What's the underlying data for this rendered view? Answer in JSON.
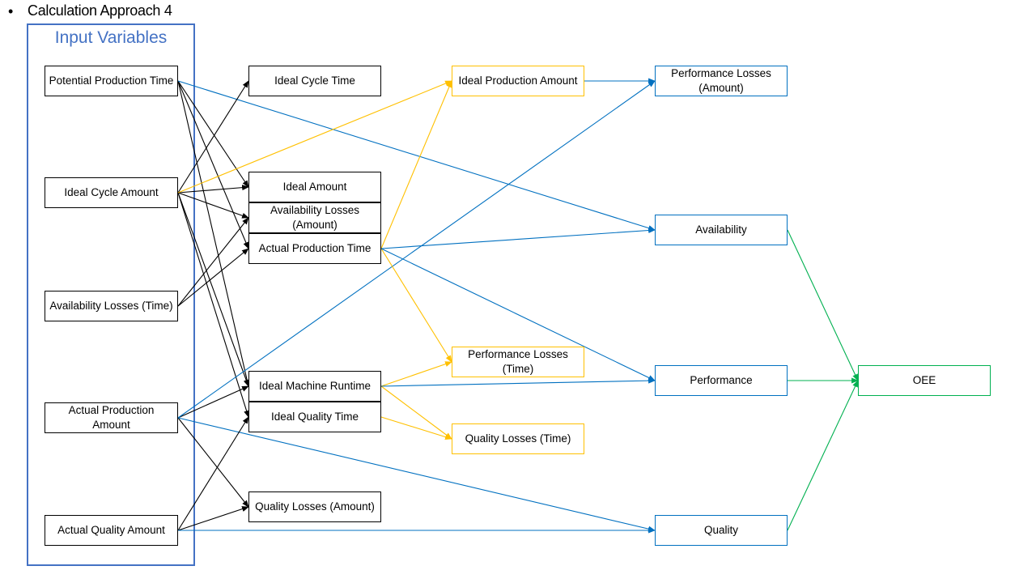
{
  "header": {
    "bullet": "•",
    "title": "Calculation Approach 4"
  },
  "group": {
    "title": "Input Variables"
  },
  "colors": {
    "input": "#000000",
    "intermediate": "#000000",
    "derived_yellow": "#FFC000",
    "kpi_blue": "#0070C0",
    "oee_green": "#00B050",
    "group_border": "#4472C4"
  },
  "nodes": [
    {
      "id": "potential_production_time",
      "label": "Potential Production Time",
      "color": "black"
    },
    {
      "id": "ideal_cycle_amount",
      "label": "Ideal Cycle Amount",
      "color": "black"
    },
    {
      "id": "availability_losses_time",
      "label": "Availability Losses (Time)",
      "color": "black"
    },
    {
      "id": "actual_production_amount",
      "label": "Actual Production Amount",
      "color": "black"
    },
    {
      "id": "actual_quality_amount",
      "label": "Actual Quality Amount",
      "color": "black"
    },
    {
      "id": "ideal_cycle_time",
      "label": "Ideal Cycle Time",
      "color": "black"
    },
    {
      "id": "ideal_amount",
      "label": "Ideal Amount",
      "color": "black"
    },
    {
      "id": "availability_losses_amount",
      "label": "Availability Losses (Amount)",
      "color": "black"
    },
    {
      "id": "actual_production_time",
      "label": "Actual Production Time",
      "color": "black"
    },
    {
      "id": "ideal_machine_runtime",
      "label": "Ideal Machine Runtime",
      "color": "black"
    },
    {
      "id": "ideal_quality_time",
      "label": "Ideal Quality Time",
      "color": "black"
    },
    {
      "id": "quality_losses_amount",
      "label": "Quality Losses (Amount)",
      "color": "black"
    },
    {
      "id": "ideal_production_amount",
      "label": "Ideal Production Amount",
      "color": "yellow"
    },
    {
      "id": "performance_losses_time",
      "label": "Performance Losses (Time)",
      "color": "yellow"
    },
    {
      "id": "quality_losses_time",
      "label": "Quality Losses (Time)",
      "color": "yellow"
    },
    {
      "id": "performance_losses_amount",
      "label": "Performance Losses (Amount)",
      "color": "blue"
    },
    {
      "id": "availability",
      "label": "Availability",
      "color": "blue"
    },
    {
      "id": "performance",
      "label": "Performance",
      "color": "blue"
    },
    {
      "id": "quality",
      "label": "Quality",
      "color": "blue"
    },
    {
      "id": "oee",
      "label": "OEE",
      "color": "green"
    }
  ],
  "edges": [
    {
      "from": "potential_production_time",
      "to": "ideal_amount",
      "color": "black"
    },
    {
      "from": "potential_production_time",
      "to": "actual_production_time",
      "color": "black"
    },
    {
      "from": "potential_production_time",
      "to": "ideal_machine_runtime",
      "color": "black"
    },
    {
      "from": "potential_production_time",
      "to": "availability",
      "color": "blue"
    },
    {
      "from": "ideal_cycle_amount",
      "to": "ideal_cycle_time",
      "color": "black"
    },
    {
      "from": "ideal_cycle_amount",
      "to": "ideal_amount",
      "color": "black"
    },
    {
      "from": "ideal_cycle_amount",
      "to": "availability_losses_amount",
      "color": "black"
    },
    {
      "from": "ideal_cycle_amount",
      "to": "ideal_machine_runtime",
      "color": "black"
    },
    {
      "from": "ideal_cycle_amount",
      "to": "ideal_quality_time",
      "color": "black"
    },
    {
      "from": "ideal_cycle_amount",
      "to": "ideal_production_amount",
      "color": "yellow"
    },
    {
      "from": "availability_losses_time",
      "to": "availability_losses_amount",
      "color": "black"
    },
    {
      "from": "availability_losses_time",
      "to": "actual_production_time",
      "color": "black"
    },
    {
      "from": "actual_production_amount",
      "to": "ideal_machine_runtime",
      "color": "black"
    },
    {
      "from": "actual_production_amount",
      "to": "quality_losses_amount",
      "color": "black"
    },
    {
      "from": "actual_production_amount",
      "to": "performance_losses_amount",
      "color": "blue"
    },
    {
      "from": "actual_production_amount",
      "to": "quality",
      "color": "blue"
    },
    {
      "from": "actual_quality_amount",
      "to": "ideal_quality_time",
      "color": "black"
    },
    {
      "from": "actual_quality_amount",
      "to": "quality_losses_amount",
      "color": "black"
    },
    {
      "from": "actual_quality_amount",
      "to": "quality",
      "color": "blue"
    },
    {
      "from": "actual_production_time",
      "to": "ideal_production_amount",
      "color": "yellow"
    },
    {
      "from": "actual_production_time",
      "to": "performance_losses_time",
      "color": "yellow"
    },
    {
      "from": "actual_production_time",
      "to": "availability",
      "color": "blue"
    },
    {
      "from": "actual_production_time",
      "to": "performance",
      "color": "blue"
    },
    {
      "from": "ideal_machine_runtime",
      "to": "performance_losses_time",
      "color": "yellow"
    },
    {
      "from": "ideal_machine_runtime",
      "to": "quality_losses_time",
      "color": "yellow"
    },
    {
      "from": "ideal_machine_runtime",
      "to": "performance",
      "color": "blue"
    },
    {
      "from": "ideal_quality_time",
      "to": "quality_losses_time",
      "color": "yellow"
    },
    {
      "from": "ideal_production_amount",
      "to": "performance_losses_amount",
      "color": "blue"
    },
    {
      "from": "availability",
      "to": "oee",
      "color": "green"
    },
    {
      "from": "performance",
      "to": "oee",
      "color": "green"
    },
    {
      "from": "quality",
      "to": "oee",
      "color": "green"
    }
  ]
}
